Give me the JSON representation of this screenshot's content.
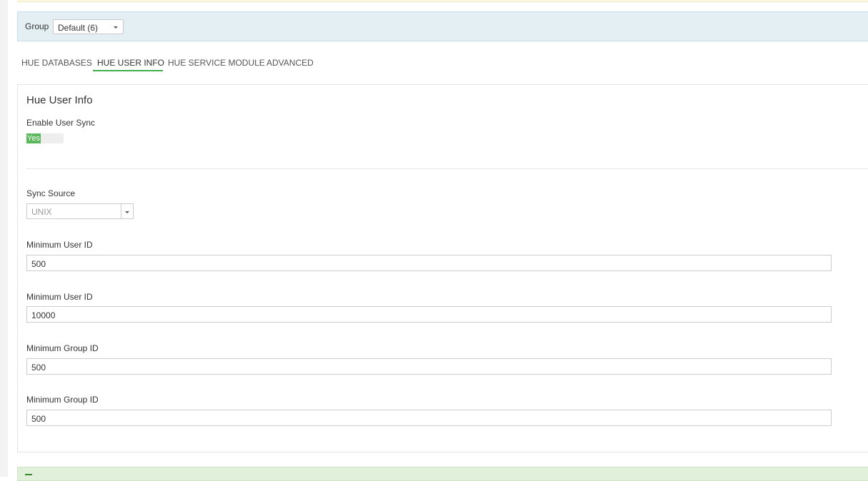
{
  "group": {
    "label": "Group",
    "selected": "Default (6)"
  },
  "tabs": [
    {
      "label": "HUE DATABASES",
      "active": false
    },
    {
      "label": "HUE USER INFO",
      "active": true
    },
    {
      "label": "HUE SERVICE MODULE",
      "active": false
    },
    {
      "label": "ADVANCED",
      "active": false
    }
  ],
  "panel": {
    "title": "Hue User Info",
    "enable_user_sync": {
      "label": "Enable User Sync",
      "value": "Yes"
    },
    "sync_source": {
      "label": "Sync Source",
      "placeholder": "UNIX"
    },
    "fields": [
      {
        "label": "Minimum User ID",
        "value": "500"
      },
      {
        "label": "Minimum User ID",
        "value": "10000"
      },
      {
        "label": "Minimum Group ID",
        "value": "500"
      },
      {
        "label": "Minimum Group ID",
        "value": "500"
      }
    ]
  },
  "colors": {
    "accent_green": "#3fae49",
    "toggle_on": "#5cb85c",
    "group_bar_bg": "#e4eff4",
    "success_bg": "#e0f0db"
  },
  "icons": {
    "group_select": "chevron-down-icon",
    "sync_source_dropdown": "chevron-down-icon",
    "success": "check-icon"
  }
}
